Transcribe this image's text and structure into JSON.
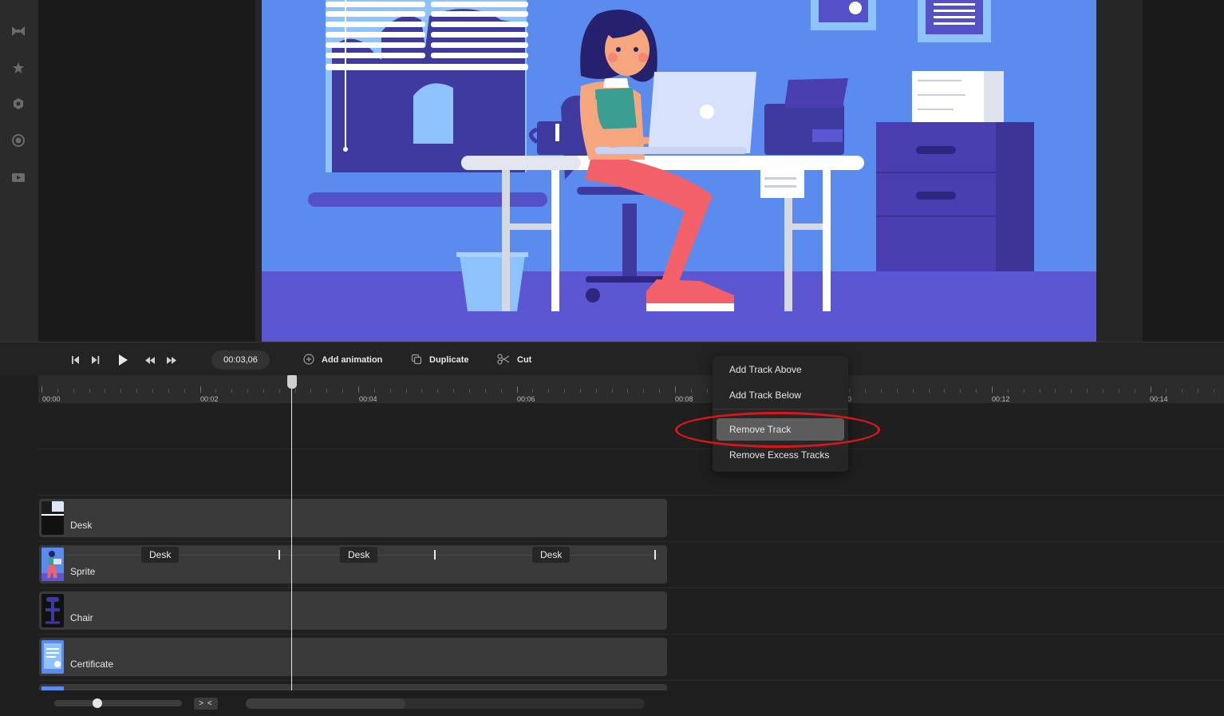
{
  "sidebar": {
    "icons": [
      "bowtie-icon",
      "star-icon",
      "hexagon-icon",
      "record-icon",
      "video-icon"
    ]
  },
  "toolbar": {
    "time": "00:03,06",
    "add_animation_label": "Add animation",
    "duplicate_label": "Duplicate",
    "cut_label": "Cut"
  },
  "ruler": {
    "labels": [
      "00:00",
      "00:02",
      "00:04",
      "00:06",
      "00:08",
      "0",
      "00:12",
      "00:14"
    ]
  },
  "tracks": [
    {
      "name": "Desk",
      "keyframes": []
    },
    {
      "name": "Sprite",
      "keyframes": [
        "Desk",
        "Desk",
        "Desk"
      ]
    },
    {
      "name": "Chair",
      "keyframes": []
    },
    {
      "name": "Certificate",
      "keyframes": []
    }
  ],
  "bottom": {
    "fit_label": "> <"
  },
  "context_menu": {
    "items": [
      "Add Track Above",
      "Add Track Below",
      "Remove Track",
      "Remove Excess Tracks"
    ],
    "highlighted": "Remove Track"
  },
  "colors": {
    "scene_bg": "#5c8bf0",
    "scene_floor": "#5b56d1",
    "accent_red": "#d9161c"
  }
}
